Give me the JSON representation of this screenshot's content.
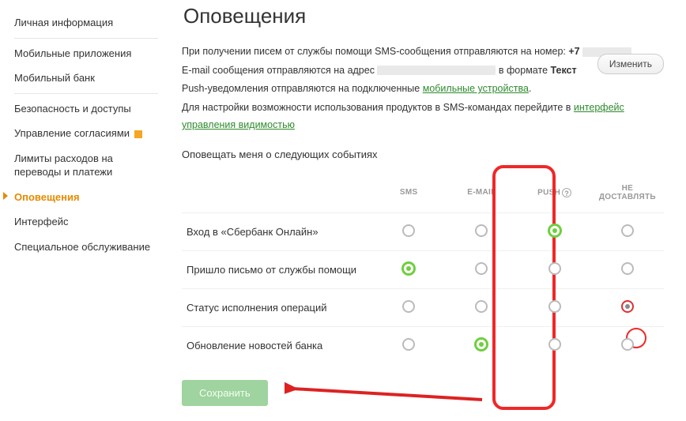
{
  "sidebar": {
    "items": [
      {
        "label": "Личная информация"
      },
      {
        "label": "Мобильные приложения"
      },
      {
        "label": "Мобильный банк"
      },
      {
        "label": "Безопасность и доступы"
      },
      {
        "label": "Управление согласиями"
      },
      {
        "label": "Лимиты расходов на переводы и платежи"
      },
      {
        "label": "Оповещения"
      },
      {
        "label": "Интерфейс"
      },
      {
        "label": "Специальное обслуживание"
      }
    ]
  },
  "page": {
    "title": "Оповещения",
    "intro": {
      "sms_prefix": "При получении писем от службы помощи SMS-сообщения отправляются на номер: ",
      "phone_prefix": "+7",
      "email_prefix": "E-mail сообщения отправляются на адрес ",
      "email_format_label": " в формате ",
      "email_format_value": "Текст",
      "push_prefix": "Push-уведомления отправляются на подключенные ",
      "push_link": "мобильные устройства",
      "push_suffix": ".",
      "hint_prefix": "Для настройки возможности использования продуктов в SMS-командах перейдите в ",
      "hint_link": "интерфейс управления видимостью",
      "change_btn": "Изменить"
    },
    "subtitle": "Оповещать меня о следующих событиях",
    "columns": {
      "event": "",
      "sms": "SMS",
      "email": "E-MAIL",
      "push": "PUSH",
      "none": "НЕ ДОСТАВЛЯТЬ"
    },
    "help_icon": "?",
    "rows": [
      {
        "label": "Вход в «Сбербанк Онлайн»",
        "selected": "push"
      },
      {
        "label": "Пришло письмо от службы помощи",
        "selected": "sms"
      },
      {
        "label": "Статус исполнения операций",
        "selected": "none"
      },
      {
        "label": "Обновление новостей банка",
        "selected": "email"
      }
    ],
    "save_btn": "Сохранить"
  }
}
